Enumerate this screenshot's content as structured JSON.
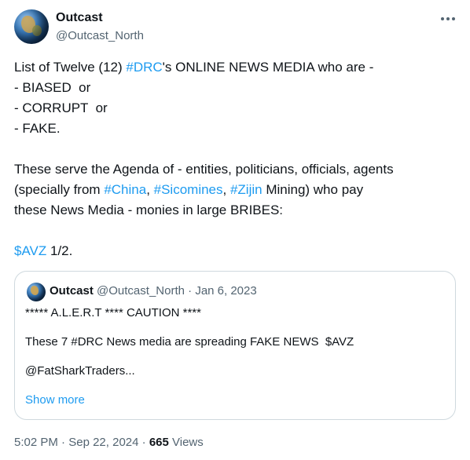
{
  "author": {
    "name": "Outcast",
    "handle": "@Outcast_North"
  },
  "tweet": {
    "lines": [
      [
        "List of Twelve (12) ",
        "#DRC",
        "'s ONLINE NEWS MEDIA who are -"
      ],
      "- BIASED  or",
      "- CORRUPT  or",
      "- FAKE.",
      "These serve the Agenda of - entities, politicians, officials, agents",
      [
        "(specially from ",
        "#China",
        ", ",
        "#Sicomines",
        ", ",
        "#Zijin",
        " Mining) who pay"
      ],
      "these News Media - monies in large BRIBES:",
      [
        "$AVZ",
        " 1/2."
      ]
    ]
  },
  "quote": {
    "name": "Outcast",
    "handle": "@Outcast_North",
    "sep": " · ",
    "date": "Jan 6, 2023",
    "line1": "***** A.L.E.R.T **** CAUTION ****",
    "line2": "These 7 #DRC News media are spreading FAKE NEWS  $AVZ",
    "line3": "@FatSharkTraders...",
    "show_more": "Show more"
  },
  "footer": {
    "time": "5:02 PM",
    "sep1": " · ",
    "date": "Sep 22, 2024",
    "sep2": " · ",
    "views": "665",
    "views_label": " Views"
  },
  "colors": {
    "link": "#1d9bf0",
    "secondary_text": "#536471",
    "primary_text": "#0f1419",
    "border": "#cfd9de"
  },
  "icons": {
    "more": "more-horizontal-icon"
  }
}
